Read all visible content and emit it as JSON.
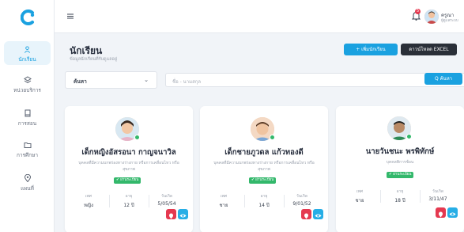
{
  "nav": [
    {
      "label": "นักเรียน",
      "icon": "person-icon",
      "active": true
    },
    {
      "label": "หน่วยบริการ",
      "icon": "layers-icon"
    },
    {
      "label": "การสอน",
      "icon": "book-icon"
    },
    {
      "label": "การศึกษา",
      "icon": "folder-icon"
    },
    {
      "label": "แผนที่",
      "icon": "map-pin-icon"
    }
  ],
  "header": {
    "notification_count": "5",
    "user_name": "ครูณา",
    "user_role": "ผู้ดูแลระบบ"
  },
  "page": {
    "title": "นักเรียน",
    "subtitle": "ข้อมูลนักเรียนที่รับดูแลอยู่"
  },
  "buttons": {
    "add": "+ เพิ่มนักเรียน",
    "download": "ดาวน์โหลด EXCEL",
    "search": "Q ค้นหา"
  },
  "search": {
    "select_label": "ค้นหา",
    "placeholder": "ชื่อ - นามสกุล"
  },
  "students": [
    {
      "name": "เด็กหญิงอัสรอนา กาญจนาวิล",
      "desc": "บุคคลที่มีความบกพร่องทางร่างกาย หรือการเคลื่อนไหว หรือสุขภาพ",
      "status": "✔ ผ่านระเบียน",
      "sex_label": "เพศ",
      "sex": "หญิง",
      "age_label": "อายุ",
      "age": "12 ปี",
      "dob_label": "วันเกิด",
      "dob": "5/05/54"
    },
    {
      "name": "เด็กชายภูวดล แก้วทองดี",
      "desc": "บุคคลที่มีความบกพร่องทางร่างกาย หรือการเคลื่อนไหว หรือสุขภาพ",
      "status": "✔ ผ่านระเบียน",
      "sex_label": "เพศ",
      "sex": "ชาย",
      "age_label": "อายุ",
      "age": "14 ปี",
      "dob_label": "วันเกิด",
      "dob": "9/01/52"
    },
    {
      "name": "นายวันชนะ พรพิทักษ์",
      "desc": "บุคคลพิการซ้อน",
      "status": "✔ ผ่านระเบียน",
      "sex_label": "เพศ",
      "sex": "ชาย",
      "age_label": "อายุ",
      "age": "18 ปี",
      "dob_label": "วันเกิด",
      "dob": "3/11/47"
    }
  ],
  "colors": {
    "primary": "#1aa1e0",
    "dark": "#2a2f38",
    "success": "#33b86b",
    "danger": "#e53950"
  }
}
